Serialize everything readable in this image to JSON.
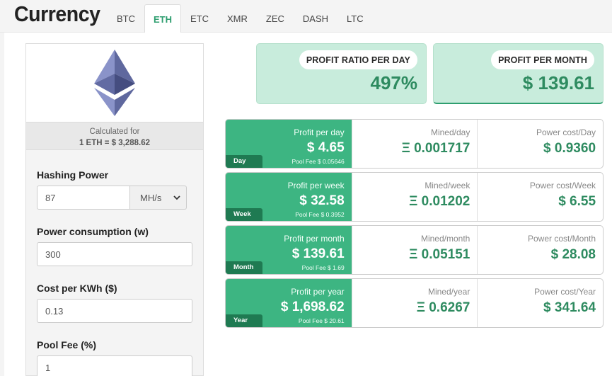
{
  "header": {
    "title": "Currency",
    "tabs": [
      {
        "label": "BTC",
        "active": false
      },
      {
        "label": "ETH",
        "active": true
      },
      {
        "label": "ETC",
        "active": false
      },
      {
        "label": "XMR",
        "active": false
      },
      {
        "label": "ZEC",
        "active": false
      },
      {
        "label": "DASH",
        "active": false
      },
      {
        "label": "LTC",
        "active": false
      }
    ]
  },
  "coin": {
    "icon": "ethereum-icon",
    "calculated_label": "Calculated for",
    "rate": "1 ETH = $ 3,288.62"
  },
  "form": {
    "hashing_power": {
      "label": "Hashing Power",
      "value": "87",
      "unit": "MH/s"
    },
    "power_consumption": {
      "label": "Power consumption (w)",
      "value": "300"
    },
    "cost_per_kwh": {
      "label": "Cost per KWh ($)",
      "value": "0.13"
    },
    "pool_fee": {
      "label": "Pool Fee (%)",
      "value": "1"
    }
  },
  "summary": {
    "ratio": {
      "label": "PROFIT RATIO PER DAY",
      "value": "497%"
    },
    "month": {
      "label": "PROFIT PER MONTH",
      "value": "$ 139.61"
    }
  },
  "periods": [
    {
      "tag": "Day",
      "profit_label": "Profit per day",
      "profit": "$ 4.65",
      "fee": "Pool Fee $ 0.05646",
      "mined_label": "Mined/day",
      "mined": "Ξ 0.001717",
      "power_label": "Power cost/Day",
      "power": "$ 0.9360"
    },
    {
      "tag": "Week",
      "profit_label": "Profit per week",
      "profit": "$ 32.58",
      "fee": "Pool Fee $ 0.3952",
      "mined_label": "Mined/week",
      "mined": "Ξ 0.01202",
      "power_label": "Power cost/Week",
      "power": "$ 6.55"
    },
    {
      "tag": "Month",
      "profit_label": "Profit per month",
      "profit": "$ 139.61",
      "fee": "Pool Fee $ 1.69",
      "mined_label": "Mined/month",
      "mined": "Ξ 0.05151",
      "power_label": "Power cost/Month",
      "power": "$ 28.08"
    },
    {
      "tag": "Year",
      "profit_label": "Profit per year",
      "profit": "$ 1,698.62",
      "fee": "Pool Fee $ 20.61",
      "mined_label": "Mined/year",
      "mined": "Ξ 0.6267",
      "power_label": "Power cost/Year",
      "power": "$ 341.64"
    }
  ],
  "colors": {
    "accent": "#3db582",
    "accent_dark": "#1f7a52",
    "value_green": "#2e8b60",
    "summary_bg": "#c8ecdc"
  }
}
